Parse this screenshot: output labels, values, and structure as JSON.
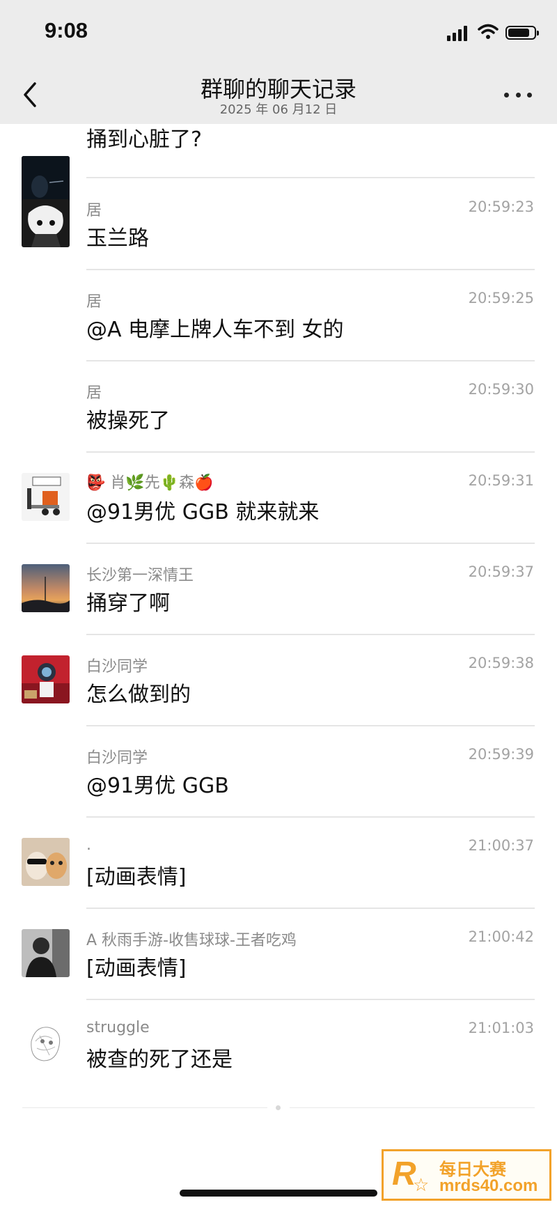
{
  "status_bar": {
    "time": "9:08"
  },
  "nav": {
    "title": "群聊的聊天记录",
    "date": "2025 年 06 月12 日",
    "back_icon": "chevron-left-icon",
    "more_icon": "more-dots-icon"
  },
  "messages": [
    {
      "sender": "",
      "time": "",
      "text": "捅到心脏了?",
      "has_avatar": true
    },
    {
      "sender": "居",
      "time": "20:59:23",
      "text": "玉兰路",
      "has_avatar": true
    },
    {
      "sender": "居",
      "time": "20:59:25",
      "text": "@A 电摩上牌人车不到 女的",
      "has_avatar": false
    },
    {
      "sender": "居",
      "time": "20:59:30",
      "text": "被操死了",
      "has_avatar": false
    },
    {
      "sender": "👺 肖🌿先🌵森🍎",
      "time": "20:59:31",
      "text": "@91男优 GGB 就来就来",
      "has_avatar": true
    },
    {
      "sender": "长沙第一深情王",
      "time": "20:59:37",
      "text": "捅穿了啊",
      "has_avatar": true
    },
    {
      "sender": "白沙同学",
      "time": "20:59:38",
      "text": "怎么做到的",
      "has_avatar": true
    },
    {
      "sender": "白沙同学",
      "time": "20:59:39",
      "text": "@91男优 GGB",
      "has_avatar": false
    },
    {
      "sender": ".",
      "time": "21:00:37",
      "text": "[动画表情]",
      "has_avatar": true
    },
    {
      "sender": "A 秋雨手游-收售球球-王者吃鸡",
      "time": "21:00:42",
      "text": "[动画表情]",
      "has_avatar": true
    },
    {
      "sender": "struggle",
      "time": "21:01:03",
      "text": "被查的死了还是",
      "has_avatar": true
    }
  ],
  "watermark": {
    "logo": "R",
    "name": "每日大赛",
    "domain": "mrds40.com"
  },
  "colors": {
    "nav_background": "#ececec",
    "divider": "#e5e5e5",
    "sender_text": "#8a8a8a",
    "time_text": "#a3a3a3",
    "watermark": "#f2a22a"
  }
}
